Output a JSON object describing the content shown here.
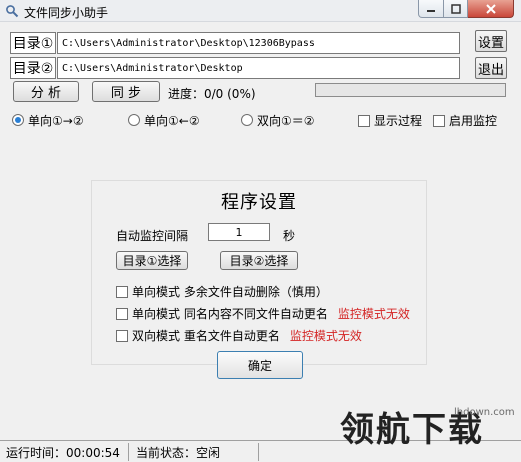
{
  "window": {
    "title": "文件同步小助手",
    "buttons": {
      "minimize": "minimize-icon",
      "maximize": "maximize-icon",
      "close": "close-icon"
    }
  },
  "dirs": [
    {
      "label": "目录①",
      "path": "C:\\Users\\Administrator\\Desktop\\12306Bypass"
    },
    {
      "label": "目录②",
      "path": "C:\\Users\\Administrator\\Desktop"
    }
  ],
  "side_buttons": {
    "settings": "设置",
    "exit": "退出"
  },
  "actions": {
    "analyze": "分 析",
    "sync": "同 步"
  },
  "progress": {
    "text": "进度：0/0 (0%)",
    "fraction": 0
  },
  "modes": [
    {
      "label": "单向①→②",
      "selected": true
    },
    {
      "label": "单向①←②",
      "selected": false
    },
    {
      "label": "双向①＝②",
      "selected": false
    }
  ],
  "toggles": {
    "show_process": "显示过程",
    "enable_monitor": "启用监控"
  },
  "settings_panel": {
    "title": "程序设置",
    "interval_label": "自动监控间隔",
    "interval_value": "1",
    "interval_unit": "秒",
    "dir1_button": "目录①选择",
    "dir2_button": "目录②选择",
    "options": [
      {
        "label": "单向模式  多余文件自动删除（慎用）",
        "note": ""
      },
      {
        "label": "单向模式  同名内容不同文件自动更名",
        "note": "监控模式无效"
      },
      {
        "label": "双向模式  重名文件自动更名",
        "note": "监控模式无效"
      }
    ],
    "ok_button": "确定"
  },
  "status": {
    "runtime": "运行时间：00:00:54",
    "state": "当前状态：空闲"
  },
  "watermark": {
    "brand": "领航下载",
    "site": "lhdown.com"
  },
  "colors": {
    "accent": "#2a7fd4",
    "warning": "#d42424",
    "close_button": "#c9473a"
  }
}
